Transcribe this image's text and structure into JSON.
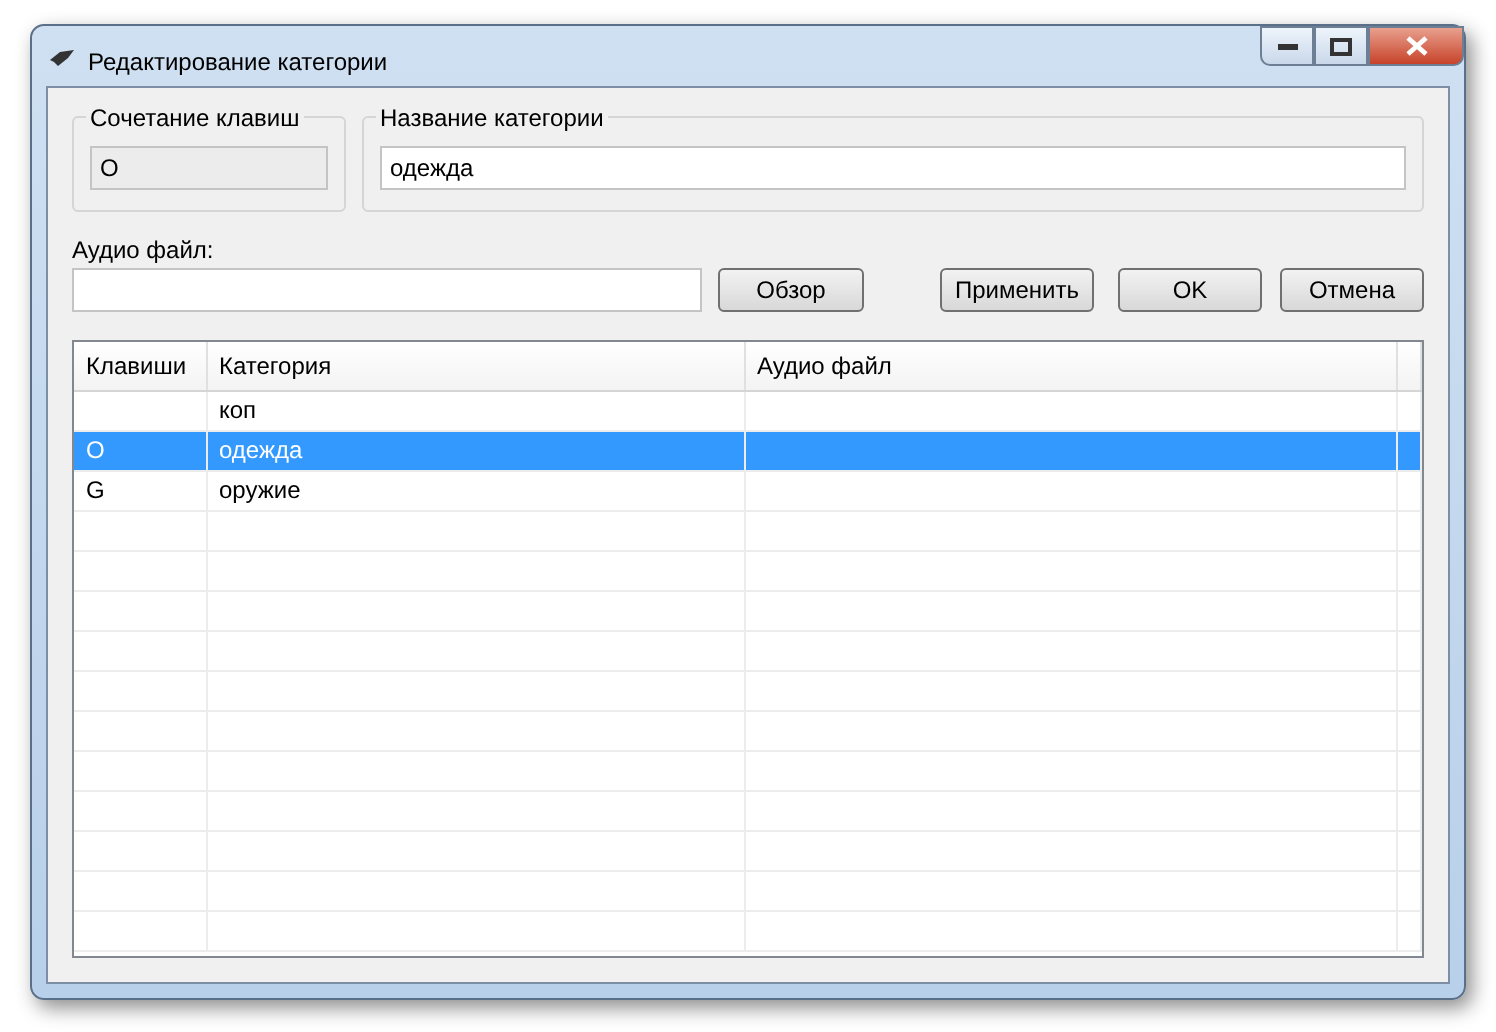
{
  "window": {
    "title": "Редактирование категории"
  },
  "shortcut_group": {
    "legend": "Сочетание клавиш",
    "value": "O"
  },
  "name_group": {
    "legend": "Название категории",
    "value": "одежда"
  },
  "audio": {
    "label": "Аудио файл:"
  },
  "buttons": [
    {
      "label": "Обзор"
    },
    {
      "label": "Применить"
    },
    {
      "label": "OK"
    },
    {
      "label": "Отмена"
    }
  ],
  "table": {
    "columns": [
      "Клавиши",
      "Категория",
      "Аудио файл"
    ],
    "rows": [
      {
        "cells": [
          "",
          "коп",
          ""
        ],
        "selected": false
      },
      {
        "cells": [
          "O",
          "одежда",
          ""
        ],
        "selected": true
      },
      {
        "cells": [
          "G",
          "оружие",
          ""
        ],
        "selected": false
      }
    ]
  }
}
